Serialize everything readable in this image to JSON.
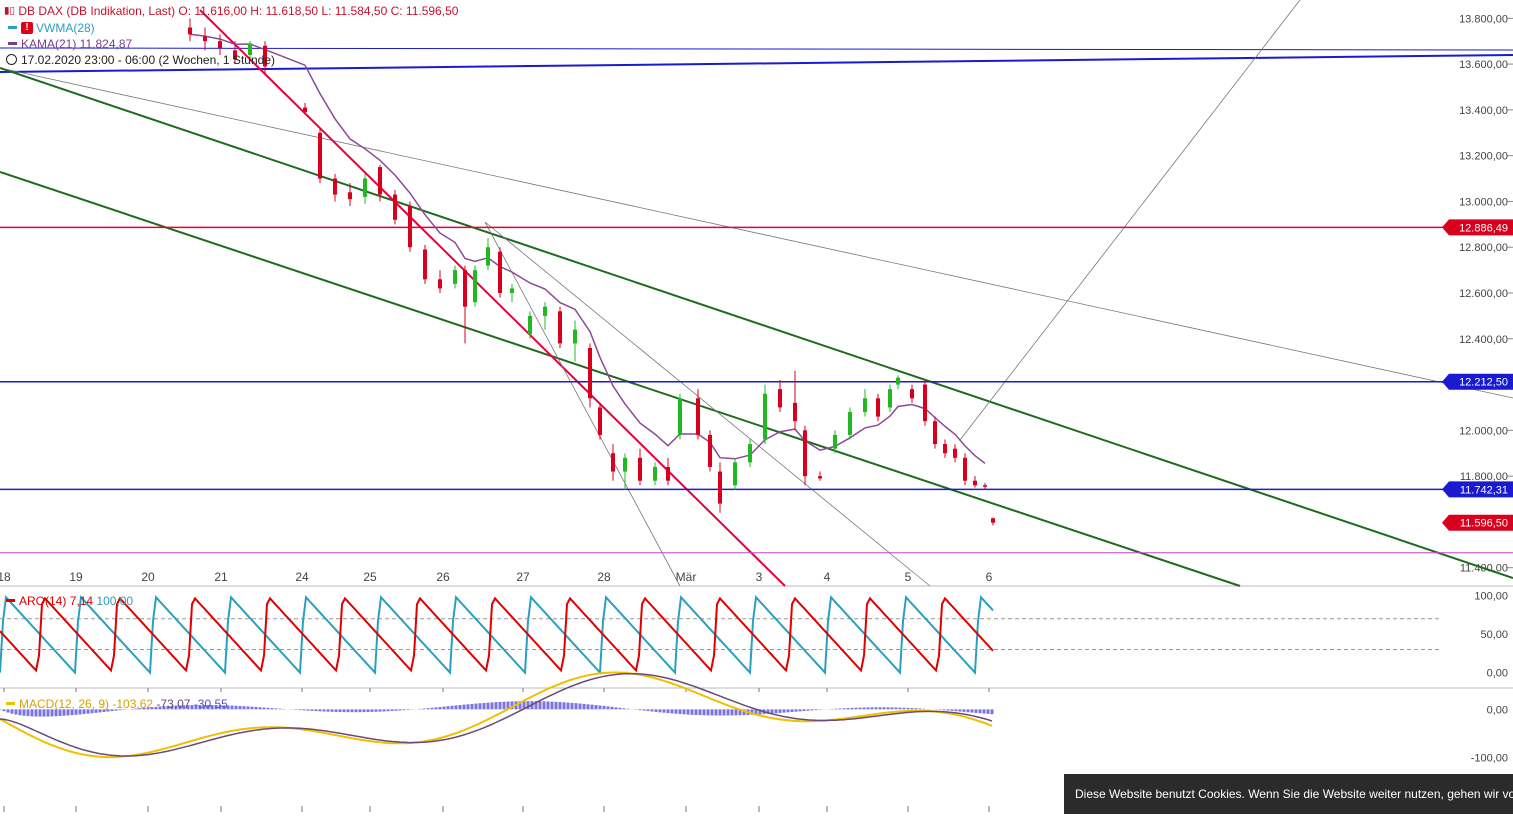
{
  "legend": {
    "main": "DB DAX (DB Indikation, Last)  O: 11.616,00  H: 11.618,50  L: 11.584,50  C: 11.596,50",
    "vwma": "VWMA(28)",
    "kama": "KAMA(21)  11.824,87",
    "timeframe": "17.02.2020 23:00 - 06:00  (2 Wochen, 1 Stunde)",
    "aro_name": "ARO(14)",
    "aro_v1": "7,14",
    "aro_v2": "100,00",
    "macd_name": "MACD(12, 26, 9)",
    "macd_v1": "-103,62",
    "macd_v2": "-73,07",
    "macd_v3": "-30,55"
  },
  "cookie_banner": "Diese Website benutzt Cookies. Wenn Sie die Website weiter nutzen, gehen wir von Ihrem Einverständnis aus.",
  "colors": {
    "up": "#22b822",
    "down": "#d8001c",
    "blue_line": "#1a1ad0",
    "green_line": "#1e6b1e",
    "red_line": "#e8003c",
    "kama": "#8a4a9a",
    "aroon_up": "#2a9fbf",
    "aroon_down": "#e00000",
    "macd": "#f0c000",
    "signal": "#6a4a7a",
    "hist": "#7b74e0",
    "magenta": "#cc44cc"
  },
  "chart_data": {
    "type": "candlestick",
    "price_axis": {
      "ylim": [
        11320,
        13880
      ],
      "ticks": [
        11400,
        11600,
        11800,
        12000,
        12200,
        12400,
        12600,
        12800,
        13000,
        13200,
        13400,
        13600,
        13800
      ],
      "tick_labels": [
        "11.400,00",
        "11.600,00",
        "11.800,00",
        "12.000,00",
        "12.200,00",
        "12.400,00",
        "12.600,00",
        "12.800,00",
        "13.000,00",
        "13.200,00",
        "13.400,00",
        "13.600,00",
        "13.800,00"
      ]
    },
    "x_axis_labels": [
      "18",
      "19",
      "20",
      "21",
      "24",
      "25",
      "26",
      "27",
      "28",
      "Mär",
      "3",
      "4",
      "5",
      "6"
    ],
    "horizontal_levels": [
      {
        "value": 12886.49,
        "label": "12.886,49",
        "color": "#e8003c",
        "label_bg": "#d8001c"
      },
      {
        "value": 12212.5,
        "label": "12.212,50",
        "color": "#1a1ad0",
        "label_bg": "#1a1ad0"
      },
      {
        "value": 11742.31,
        "label": "11.742,31",
        "color": "#1a1ad0",
        "label_bg": "#1a1ad0"
      },
      {
        "value": 11596.5,
        "label": "11.596,50",
        "color": null,
        "label_bg": "#d8001c"
      },
      {
        "value": 11465,
        "label": "",
        "color": "#cc44cc",
        "label_bg": null
      }
    ],
    "candles": [
      {
        "x": 190,
        "o": 13760,
        "h": 13800,
        "l": 13700,
        "c": 13730
      },
      {
        "x": 205,
        "o": 13720,
        "h": 13760,
        "l": 13660,
        "c": 13700
      },
      {
        "x": 220,
        "o": 13700,
        "h": 13730,
        "l": 13640,
        "c": 13670
      },
      {
        "x": 235,
        "o": 13660,
        "h": 13700,
        "l": 13600,
        "c": 13620
      },
      {
        "x": 250,
        "o": 13640,
        "h": 13700,
        "l": 13620,
        "c": 13690
      },
      {
        "x": 265,
        "o": 13680,
        "h": 13700,
        "l": 13560,
        "c": 13590
      },
      {
        "x": 305,
        "o": 13410,
        "h": 13430,
        "l": 13380,
        "c": 13390
      },
      {
        "x": 320,
        "o": 13300,
        "h": 13320,
        "l": 13080,
        "c": 13100
      },
      {
        "x": 335,
        "o": 13100,
        "h": 13120,
        "l": 13000,
        "c": 13030
      },
      {
        "x": 350,
        "o": 13040,
        "h": 13080,
        "l": 12980,
        "c": 13010
      },
      {
        "x": 365,
        "o": 13020,
        "h": 13120,
        "l": 12990,
        "c": 13100
      },
      {
        "x": 380,
        "o": 13150,
        "h": 13160,
        "l": 13000,
        "c": 13030
      },
      {
        "x": 395,
        "o": 13030,
        "h": 13050,
        "l": 12900,
        "c": 12920
      },
      {
        "x": 410,
        "o": 12980,
        "h": 13000,
        "l": 12780,
        "c": 12800
      },
      {
        "x": 425,
        "o": 12790,
        "h": 12810,
        "l": 12640,
        "c": 12660
      },
      {
        "x": 440,
        "o": 12660,
        "h": 12700,
        "l": 12600,
        "c": 12620
      },
      {
        "x": 455,
        "o": 12640,
        "h": 12720,
        "l": 12620,
        "c": 12700
      },
      {
        "x": 465,
        "o": 12700,
        "h": 12720,
        "l": 12380,
        "c": 12540
      },
      {
        "x": 475,
        "o": 12560,
        "h": 12720,
        "l": 12540,
        "c": 12700
      },
      {
        "x": 488,
        "o": 12720,
        "h": 12840,
        "l": 12700,
        "c": 12800
      },
      {
        "x": 500,
        "o": 12780,
        "h": 12800,
        "l": 12580,
        "c": 12600
      },
      {
        "x": 512,
        "o": 12600,
        "h": 12640,
        "l": 12560,
        "c": 12620
      },
      {
        "x": 530,
        "o": 12420,
        "h": 12520,
        "l": 12400,
        "c": 12500
      },
      {
        "x": 545,
        "o": 12500,
        "h": 12560,
        "l": 12440,
        "c": 12540
      },
      {
        "x": 560,
        "o": 12520,
        "h": 12540,
        "l": 12360,
        "c": 12380
      },
      {
        "x": 575,
        "o": 12380,
        "h": 12480,
        "l": 12300,
        "c": 12440
      },
      {
        "x": 590,
        "o": 12360,
        "h": 12380,
        "l": 12100,
        "c": 12140
      },
      {
        "x": 600,
        "o": 12100,
        "h": 12120,
        "l": 11960,
        "c": 11980
      },
      {
        "x": 613,
        "o": 11900,
        "h": 11940,
        "l": 11780,
        "c": 11820
      },
      {
        "x": 625,
        "o": 11820,
        "h": 11900,
        "l": 11740,
        "c": 11880
      },
      {
        "x": 640,
        "o": 11880,
        "h": 11920,
        "l": 11760,
        "c": 11780
      },
      {
        "x": 655,
        "o": 11780,
        "h": 11860,
        "l": 11760,
        "c": 11840
      },
      {
        "x": 668,
        "o": 11840,
        "h": 11880,
        "l": 11760,
        "c": 11780
      },
      {
        "x": 680,
        "o": 11980,
        "h": 12160,
        "l": 11960,
        "c": 12140
      },
      {
        "x": 698,
        "o": 12140,
        "h": 12180,
        "l": 11960,
        "c": 11980
      },
      {
        "x": 710,
        "o": 11980,
        "h": 12000,
        "l": 11820,
        "c": 11840
      },
      {
        "x": 720,
        "o": 11820,
        "h": 11860,
        "l": 11640,
        "c": 11680
      },
      {
        "x": 735,
        "o": 11760,
        "h": 11880,
        "l": 11740,
        "c": 11860
      },
      {
        "x": 750,
        "o": 11860,
        "h": 11960,
        "l": 11840,
        "c": 11940
      },
      {
        "x": 765,
        "o": 11960,
        "h": 12200,
        "l": 11940,
        "c": 12160
      },
      {
        "x": 780,
        "o": 12180,
        "h": 12220,
        "l": 12080,
        "c": 12100
      },
      {
        "x": 795,
        "o": 12120,
        "h": 12260,
        "l": 12000,
        "c": 12040
      },
      {
        "x": 805,
        "o": 12000,
        "h": 12020,
        "l": 11760,
        "c": 11800
      },
      {
        "x": 820,
        "o": 11800,
        "h": 11820,
        "l": 11780,
        "c": 11790
      },
      {
        "x": 835,
        "o": 11920,
        "h": 12000,
        "l": 11900,
        "c": 11980
      },
      {
        "x": 850,
        "o": 11980,
        "h": 12100,
        "l": 11960,
        "c": 12080
      },
      {
        "x": 865,
        "o": 12080,
        "h": 12180,
        "l": 12060,
        "c": 12140
      },
      {
        "x": 878,
        "o": 12140,
        "h": 12160,
        "l": 12040,
        "c": 12060
      },
      {
        "x": 890,
        "o": 12100,
        "h": 12200,
        "l": 12080,
        "c": 12180
      },
      {
        "x": 898,
        "o": 12200,
        "h": 12240,
        "l": 12180,
        "c": 12230
      },
      {
        "x": 912,
        "o": 12180,
        "h": 12200,
        "l": 12120,
        "c": 12140
      },
      {
        "x": 925,
        "o": 12200,
        "h": 12220,
        "l": 12020,
        "c": 12040
      },
      {
        "x": 935,
        "o": 12040,
        "h": 12060,
        "l": 11920,
        "c": 11940
      },
      {
        "x": 945,
        "o": 11940,
        "h": 11960,
        "l": 11880,
        "c": 11900
      },
      {
        "x": 955,
        "o": 11920,
        "h": 11940,
        "l": 11860,
        "c": 11880
      },
      {
        "x": 965,
        "o": 11880,
        "h": 11900,
        "l": 11760,
        "c": 11780
      },
      {
        "x": 975,
        "o": 11780,
        "h": 11800,
        "l": 11750,
        "c": 11760
      },
      {
        "x": 985,
        "o": 11760,
        "h": 11770,
        "l": 11740,
        "c": 11755
      },
      {
        "x": 993,
        "o": 11616,
        "h": 11618.5,
        "l": 11584.5,
        "c": 11596.5
      }
    ],
    "aroon": {
      "ylim": [
        -20,
        110
      ],
      "ticks": [
        0,
        50,
        100
      ],
      "tick_labels": [
        "0,00",
        "50,00",
        "100,00"
      ],
      "up_last": 100.0,
      "down_last": 7.14
    },
    "macd": {
      "ylim": [
        -200,
        40
      ],
      "ticks": [
        -100,
        0
      ],
      "tick_labels": [
        "-100,00",
        "0,00"
      ],
      "macd_last": -103.62,
      "signal_last": -73.07,
      "hist_last": -30.55
    }
  }
}
